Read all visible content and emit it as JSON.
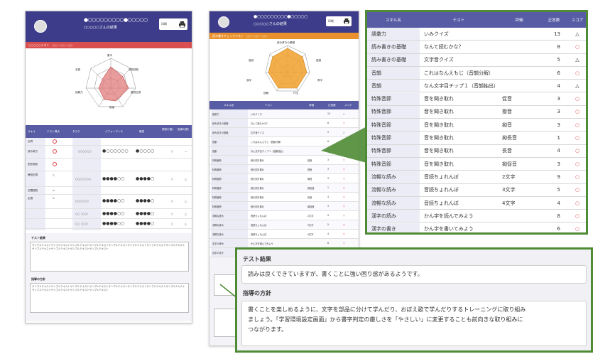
{
  "sheet1": {
    "header": {
      "title_dots": "●○○○○○○○○○●○○○○○",
      "subtitle": "○○○○○さんの結果",
      "print_label": "印刷"
    },
    "band_text": "○○○○○テスト　○○・○○・○○",
    "radar_labels": [
      "集中",
      "言語",
      "読解力",
      "視覚認知",
      "聴覚記憶",
      "推論",
      "処理速度"
    ],
    "table_header": [
      "スキル",
      "テスト得点",
      "タスク",
      "パフォーマンス",
      "聴覚",
      "視覚の割合",
      "指導の提示"
    ],
    "left_rows": [
      "計算",
      "読み書き",
      "図形認知",
      "",
      "聴覚記憶",
      "",
      "空間認知",
      "記憶"
    ],
    "section_title_1": "テスト結果",
    "section_title_2": "指導の方針",
    "lorem": "サンプルテキストサンプルテキストサンプルテキストサンプルテキストサンプルテキストサンプルテキストサンプルテキストサンプルテキストサンプルテキストサンプルテキストサンプルテキストサンプルテキスト"
  },
  "sheet2": {
    "header": {
      "title_dots": "●○○○○○○○○○●○○○○○",
      "subtitle": "○○○○○さんの結果",
      "print_label": "印刷"
    },
    "band_text": "読み書きチェックテスト　○○・○○・○○",
    "radar_labels": [
      "読み書きの基礎",
      "音読",
      "語彙",
      "漢字",
      "書字",
      "読解",
      "作文"
    ],
    "table_header": [
      "スキル名",
      "テスト",
      "評価",
      "正答数",
      "スコア"
    ]
  },
  "zoom_table": {
    "headers": [
      "スキル名",
      "テスト",
      "評価",
      "正答数",
      "スコア"
    ],
    "rows": [
      {
        "skill": "語彙力",
        "test": "いみクイズ",
        "level": "",
        "count": "13",
        "mark": "△"
      },
      {
        "skill": "読み書きの基礎",
        "test": "なんて読むかな？",
        "level": "",
        "count": "8",
        "mark": "○"
      },
      {
        "skill": "読み書きの基礎",
        "test": "文字音クイズ",
        "level": "",
        "count": "5",
        "mark": "△"
      },
      {
        "skill": "音韻",
        "test": "これはなんえもじ（音韻分解）",
        "level": "",
        "count": "6",
        "mark": "○"
      },
      {
        "skill": "音韻",
        "test": "なん文字目チップ１（音韻抽出）",
        "level": "",
        "count": "4",
        "mark": "△"
      },
      {
        "skill": "特殊音節",
        "test": "音を聞き取れ",
        "level": "促音",
        "count": "3",
        "mark": "○"
      },
      {
        "skill": "特殊音節",
        "test": "音を聞き取れ",
        "level": "撥音",
        "count": "3",
        "mark": "○"
      },
      {
        "skill": "特殊音節",
        "test": "音を聞き取れ",
        "level": "拗音",
        "count": "3",
        "mark": "○"
      },
      {
        "skill": "特殊音節",
        "test": "音を聞き取れ",
        "level": "拗長音",
        "count": "1",
        "mark": "○"
      },
      {
        "skill": "特殊音節",
        "test": "音を聞き取れ",
        "level": "長音",
        "count": "4",
        "mark": "○"
      },
      {
        "skill": "特殊音節",
        "test": "音を聞き取れ",
        "level": "拗促音",
        "count": "3",
        "mark": "○"
      },
      {
        "skill": "流暢な読み",
        "test": "音読ちょれんぼ",
        "level": "2文字",
        "count": "9",
        "mark": "○"
      },
      {
        "skill": "流暢な読み",
        "test": "音読ちょれんぼ",
        "level": "3文字",
        "count": "5",
        "mark": "○"
      },
      {
        "skill": "流暢な読み",
        "test": "音読ちょれんぼ",
        "level": "4文字",
        "count": "4",
        "mark": "○"
      },
      {
        "skill": "漢字の読み",
        "test": "かん字を読んでみよう",
        "level": "",
        "count": "8",
        "mark": "○"
      },
      {
        "skill": "漢字の書き",
        "test": "かん字を書いてみよう",
        "level": "",
        "count": "6",
        "mark": "○"
      }
    ]
  },
  "zoom_feedback": {
    "title_result": "テスト結果",
    "result_text": "読みは良くできていますが、書くことに強い困り感があるようです。",
    "title_guidance": "指導の方針",
    "guidance_line1": "書くことを楽しめるように、文字を部品に分けて学んだり、おぼえ歌で学んだりするトレーニングに取り組み",
    "guidance_line2": "ましょう。「学習環境設定画面」から書字判定の厳しさを「やさしい」に変更することも前向きな取り組みに",
    "guidance_line3": "つながります。"
  },
  "colors": {
    "header": "#3c3c8a",
    "band_red": "#d94f4f",
    "band_orange": "#e9912c",
    "green": "#4e8b34",
    "table_head": "#575ca5",
    "red_mark": "#e04040"
  }
}
